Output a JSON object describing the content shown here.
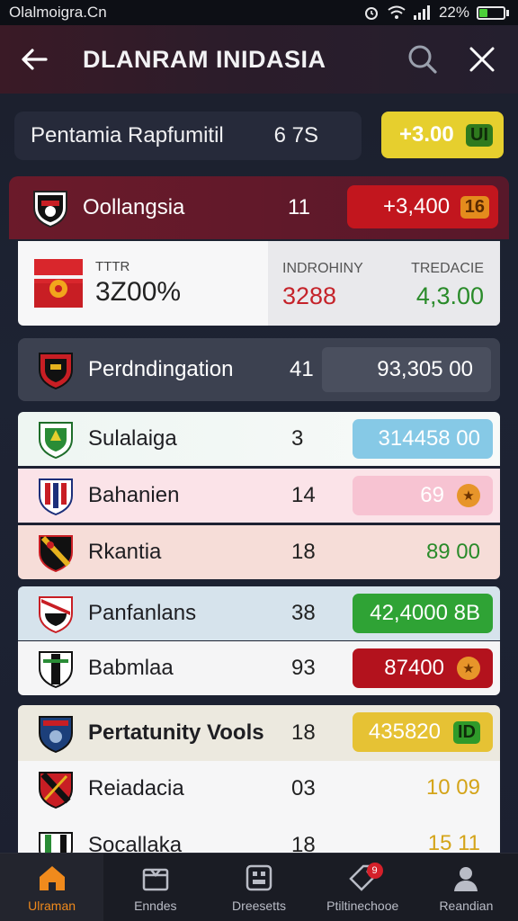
{
  "status_bar": {
    "carrier": "Olalmoigra.Cn",
    "battery": "22%"
  },
  "app_bar": {
    "title": "DLANRAM INIDASIA"
  },
  "summary": {
    "label": "Pentamia Rapfumitil",
    "value": "6 7S",
    "badge_value": "+3.00",
    "badge_tag": "UI"
  },
  "header_row": {
    "name": "Oollangsia",
    "number": "11",
    "pill_value": "+3,400",
    "pill_tag": "16"
  },
  "info_card": {
    "small_label": "TTTR",
    "big_value": "3Z00%",
    "stat1_label": "INDROHINY",
    "stat1_value": "3288",
    "stat2_label": "TREDACIE",
    "stat2_value": "4,3.00"
  },
  "dark_row": {
    "name": "Perdndingation",
    "number": "41",
    "pill_value": "93,305  00"
  },
  "rows": [
    {
      "name": "Sulalaiga",
      "number": "3",
      "pill_value": "314458  00",
      "pill_bg": "#86c9e6"
    },
    {
      "name": "Bahanien",
      "number": "14",
      "pill_value": "69",
      "pill_bg": "#f7c3d2"
    },
    {
      "name": "Rkantia",
      "number": "18",
      "pill_value": "89  00",
      "pill_bg": "transparent"
    },
    {
      "name": "Panfanlans",
      "number": "38",
      "pill_value": "42,4000  8B",
      "pill_bg": "#2fa335"
    },
    {
      "name": "Babmlaa",
      "number": "93",
      "pill_value": "87400",
      "pill_bg": "#b3121d"
    },
    {
      "name": "Pertatunity Vools",
      "number": "18",
      "pill_value": "435820",
      "pill_tag": "ID",
      "pill_bg": "#e6c234"
    },
    {
      "name": "Reiadacia",
      "number": "03",
      "pill_value": "10  09",
      "pill_bg": "transparent"
    },
    {
      "name": "Socallaka",
      "number": "18",
      "pill_value": "15  11",
      "pill_bg": "transparent"
    }
  ],
  "bottom_nav": [
    {
      "label": "Ulraman",
      "icon": "home-icon"
    },
    {
      "label": "Enndes",
      "icon": "box-icon"
    },
    {
      "label": "Dreesetts",
      "icon": "board-icon"
    },
    {
      "label": "Ptiltinechooe",
      "icon": "tag-icon",
      "badge": "9"
    },
    {
      "label": "Reandian",
      "icon": "profile-icon"
    }
  ],
  "colors": {
    "accent": "#f08a1c",
    "red": "#c2161e",
    "yellow": "#e6cf2e",
    "green": "#2fa335"
  }
}
